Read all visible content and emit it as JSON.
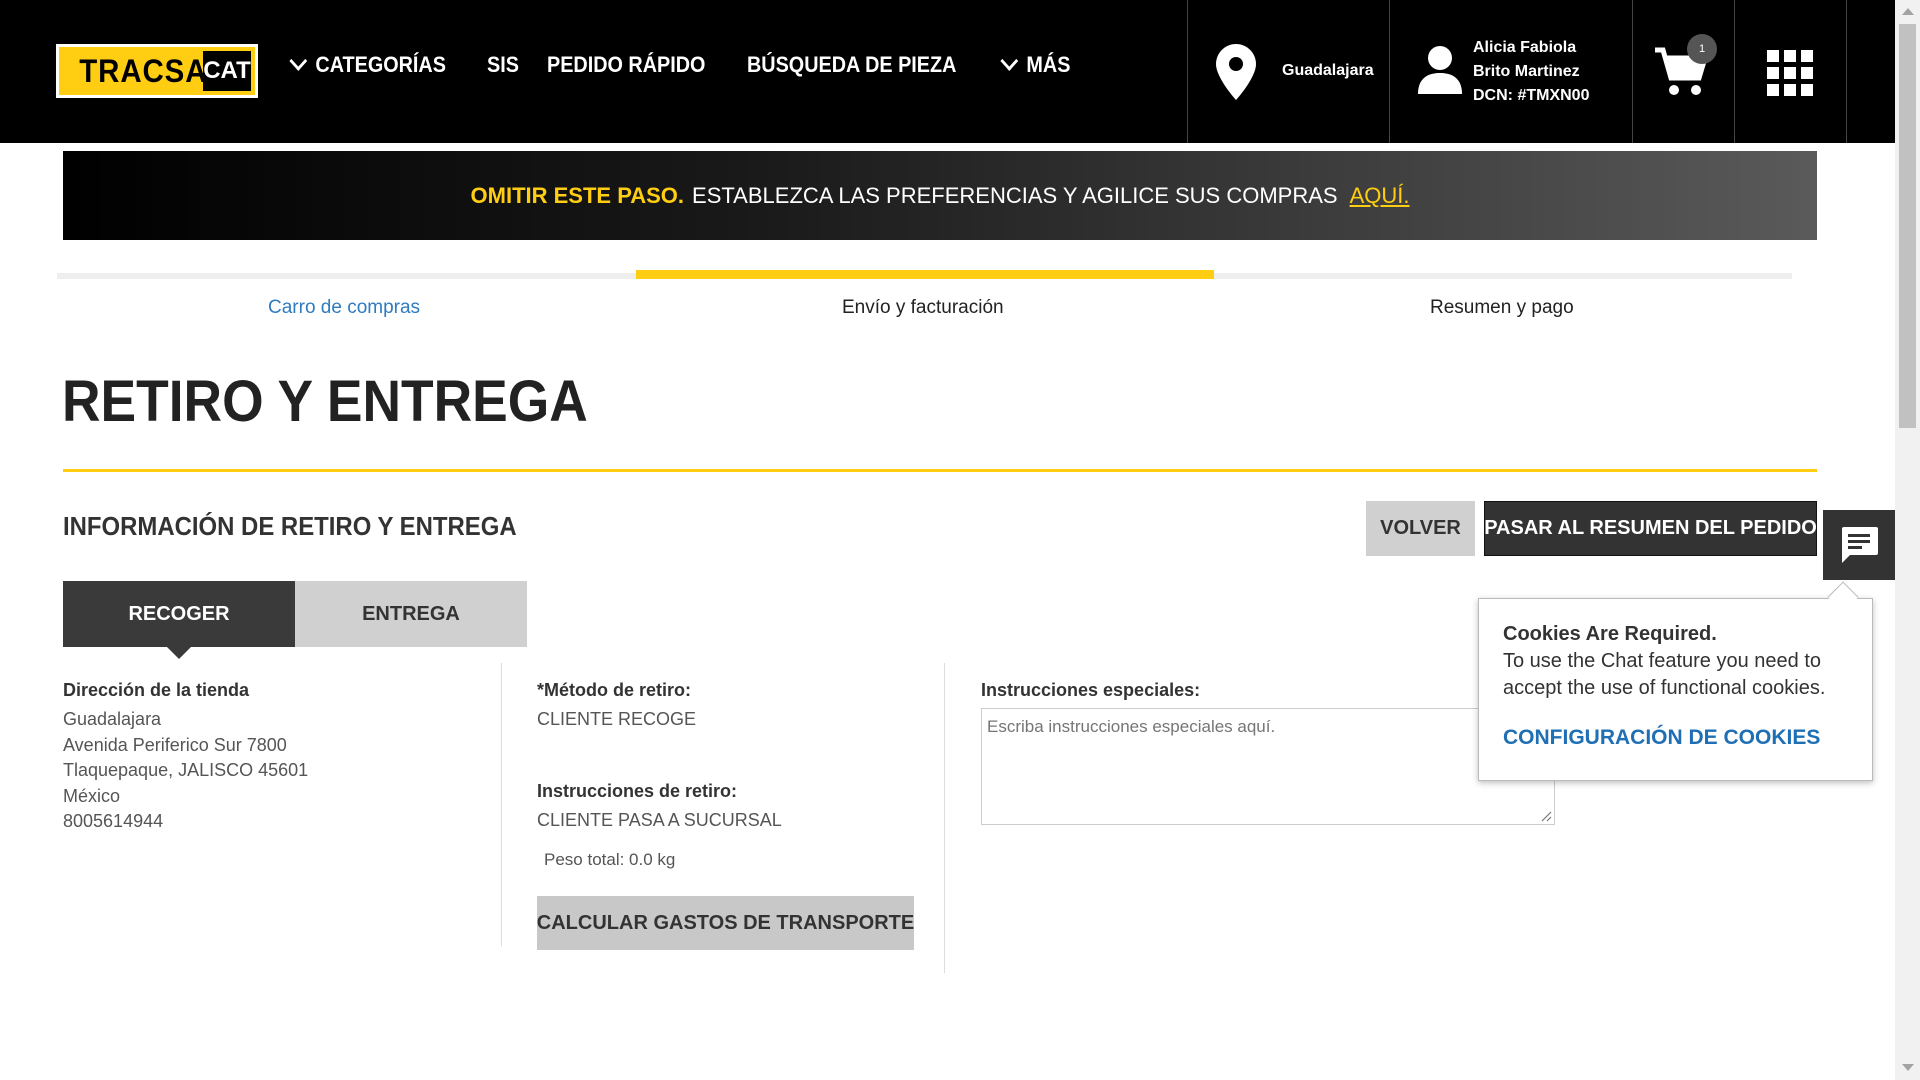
{
  "header": {
    "logo_text": "TRACSA",
    "logo_badge": "CAT",
    "nav": [
      {
        "label": "CATEGORÍAS",
        "has_chevron": true
      },
      {
        "label": "SIS",
        "has_chevron": false
      },
      {
        "label": "PEDIDO RÁPIDO",
        "has_chevron": false
      },
      {
        "label": "BÚSQUEDA DE PIEZA",
        "has_chevron": false
      },
      {
        "label": "MÁS",
        "has_chevron": true
      }
    ],
    "location": "Guadalajara",
    "user_line1": "Alicia Fabiola",
    "user_line2": "Brito Martinez",
    "user_line3": "DCN: #TMXN00",
    "cart_count": "1",
    "icons": [
      "location-pin-icon",
      "user-icon",
      "cart-icon",
      "apps-grid-icon"
    ]
  },
  "promo": {
    "strong": "OMITIR ESTE PASO.",
    "text": "ESTABLEZCA LAS PREFERENCIAS Y AGILICE SUS COMPRAS",
    "link": "AQUÍ."
  },
  "steps": [
    {
      "label": "Carro de compras",
      "state": "done"
    },
    {
      "label": "Envío y facturación",
      "state": "active"
    },
    {
      "label": "Resumen y pago",
      "state": "pending"
    }
  ],
  "page_title": "RETIRO Y ENTREGA",
  "section_title": "INFORMACIÓN DE RETIRO Y ENTREGA",
  "buttons": {
    "back": "VOLVER",
    "next": "PASAR AL RESUMEN DEL PEDIDO",
    "calc": "CALCULAR GASTOS DE TRANSPORTE"
  },
  "tabs": [
    {
      "label": "RECOGER",
      "active": true
    },
    {
      "label": "ENTREGA",
      "active": false
    }
  ],
  "store": {
    "label": "Dirección de la tienda",
    "lines": [
      "Guadalajara",
      "Avenida Periferico Sur 7800",
      "Tlaquepaque, JALISCO 45601",
      "México",
      "8005614944"
    ]
  },
  "pickup": {
    "method_label": "*Método de retiro:",
    "method_value": "CLIENTE RECOGE",
    "instr_label": "Instrucciones de retiro:",
    "instr_value": "CLIENTE PASA A SUCURSAL",
    "weight": "Peso total: 0.0 kg"
  },
  "special": {
    "label": "Instrucciones especiales:",
    "placeholder": "Escriba instrucciones especiales aquí.",
    "value": ""
  },
  "cookie": {
    "title": "Cookies Are Required.",
    "body": "To use the Chat feature you need to accept the use of functional cookies.",
    "link": "CONFIGURACIÓN DE COOKIES"
  },
  "colors": {
    "brand_yellow": "#ffcd11",
    "header_bg": "#000000",
    "link_blue": "#2e7bbf",
    "dark_button": "#333333"
  }
}
